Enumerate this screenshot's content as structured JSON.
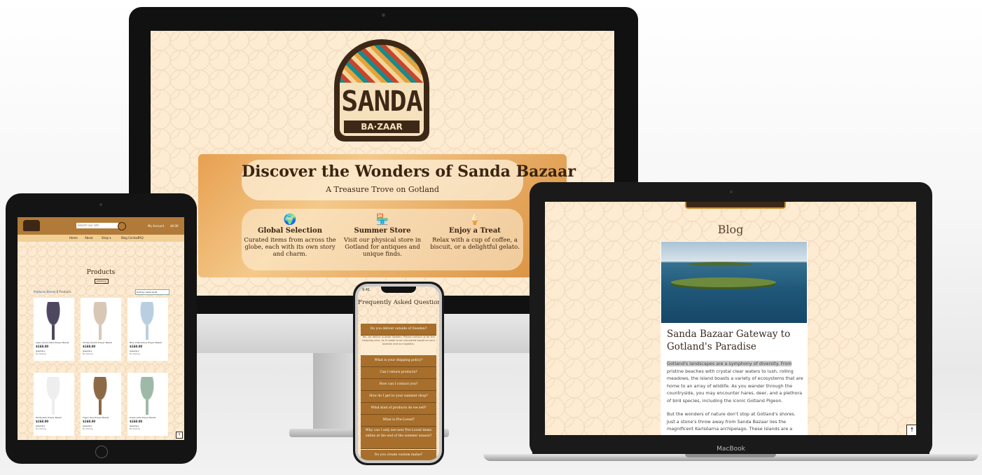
{
  "desktop": {
    "logo": {
      "title": "SANDA",
      "subtitle": "BA·ZAAR"
    },
    "hero": {
      "title": "Discover the Wonders of Sanda Bazaar",
      "subtitle": "A Treasure Trove on Gotland",
      "features": [
        {
          "icon": "globe-icon",
          "glyph": "🌍",
          "title": "Global Selection",
          "text": "Curated items from across the globe, each with its own story and charm."
        },
        {
          "icon": "store-icon",
          "glyph": "🏪",
          "title": "Summer Store",
          "text": "Visit our physical store in Gotland for antiques and unique finds."
        },
        {
          "icon": "ice-cream-icon",
          "glyph": "🍦",
          "title": "Enjoy a Treat",
          "text": "Relax with a cup of coffee, a biscuit, or a delightful gelato."
        }
      ]
    }
  },
  "tablet": {
    "search_placeholder": "Search our site",
    "account": "My Account",
    "cart": "$0.00",
    "nav": [
      "Home",
      "About",
      "Shop ▾",
      "Blog",
      "Contact",
      "FAQ"
    ],
    "heading": "Products",
    "badge": "Jewellery",
    "breadcrumb_home": "Products Home",
    "count": "| 6 Products",
    "sort_label": "Sort by: name (A-Z)",
    "products": [
      {
        "name": "Lapis Lazuli Glass Prayer Beads",
        "price": "$168.00",
        "category": "Jewellery",
        "rating": "No Rating",
        "color": "#4f4660"
      },
      {
        "name": "Smoky Quartz Prayer Beads",
        "price": "$168.00",
        "category": "Jewellery",
        "rating": "No Rating",
        "color": "#d9c7b6"
      },
      {
        "name": "Blue Chalcedony Prayer Beads",
        "price": "$168.00",
        "category": "Jewellery",
        "rating": "No Rating",
        "color": "#b9cfe0"
      },
      {
        "name": "White Jade Prayer Beads",
        "price": "$168.00",
        "category": "Jewellery",
        "rating": "No Rating",
        "color": "#eeeeee"
      },
      {
        "name": "Tiger's Eye Prayer Beads",
        "price": "$168.00",
        "category": "Jewellery",
        "rating": "No Rating",
        "color": "#8b6a45"
      },
      {
        "name": "Green Jade Prayer Beads",
        "price": "$168.00",
        "category": "Jewellery",
        "rating": "No Rating",
        "color": "#9fb9a8"
      }
    ],
    "scroll_top": "↑"
  },
  "phone": {
    "time": "9:41",
    "title": "Frequently Asked Questions",
    "questions": [
      "Do you deliver outside of Sweden?",
      "What is your shipping policy?",
      "Can I return products?",
      "How can I contact you?",
      "How do I get to your summer shop?",
      "What kind of products do we sell?",
      "What is Pre-Loved?",
      "Why can I only see new Pre-Loved items online at the end of the summer season?",
      "Do you create custom malas?"
    ],
    "answer": "Yes, we deliver outside Sweden. Please contact us for the shipping price, as it needs to be calculated based on your location and our logistics."
  },
  "laptop": {
    "heading": "Blog",
    "post_title": "Sanda Bazaar Gateway to Gotland's Paradise",
    "highlight": "Gotland's landscapes are a symphony of diversity. From",
    "p1_rest": " pristine beaches with crystal clear waters to lush, rolling meadows, the island boasts a variety of ecosystems that are home to an array of wildlife. As you wander through the countryside, you may encounter hares, deer, and a plethora of bird species, including the iconic Gotland Pigeon.",
    "p2": "But the wonders of nature don't stop at Gotland's shores. Just a stone's throw away from Sanda Bazaar lies the magnificent Karlsöarna archipelago. These islands are a",
    "scroll_top": "↑",
    "brand": "MacBook"
  }
}
